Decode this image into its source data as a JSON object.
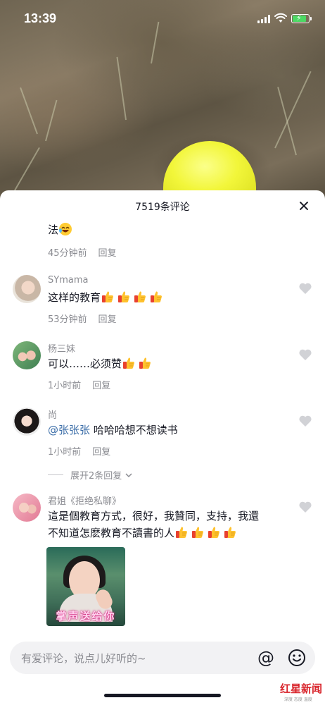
{
  "status_bar": {
    "time": "13:39"
  },
  "sheet": {
    "title": "7519条评论"
  },
  "comments": [
    {
      "username": "",
      "text": "法",
      "emoji_suffix": "laughing-crying",
      "time": "45分钟前",
      "reply_label": "回复"
    },
    {
      "username": "SYmama",
      "text": "这样的教育",
      "emoji_suffix": "thumbs-up x4",
      "time": "53分钟前",
      "reply_label": "回复"
    },
    {
      "username": "杨三妹",
      "text": "可以……必须赞",
      "emoji_suffix": "thumbs-up x2",
      "time": "1小时前",
      "reply_label": "回复"
    },
    {
      "username": "尚",
      "mention": "@张张张",
      "text": " 哈哈哈想不想读书",
      "time": "1小时前",
      "reply_label": "回复",
      "expand_label": "展开2条回复"
    },
    {
      "username": "君姐《拒绝私聊》",
      "text_line1": "這是個教育方式，很好，我贊同，支持，我還",
      "text_line2": "不知道怎麽教育不讀書的人",
      "emoji_suffix": "thumbs-up x4",
      "sticker_caption": "掌声送给你"
    }
  ],
  "input": {
    "placeholder": "有爱评论，说点儿好听的~",
    "at_symbol": "@"
  },
  "watermark": {
    "brand": "红星新闻",
    "tagline": "深度 态度 温度"
  },
  "colors": {
    "accent_blue": "#3d6fa9",
    "muted_gray": "#8a8b91",
    "text_dark": "#161823",
    "helmet_yellow": "#f2f63a"
  }
}
